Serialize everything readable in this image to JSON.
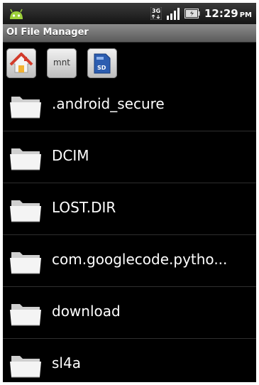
{
  "status_bar": {
    "time": "12:29",
    "ampm": "PM",
    "icons": [
      "android-icon",
      "3g-icon",
      "signal-icon",
      "battery-icon"
    ]
  },
  "title_bar": {
    "title": "OI File Manager"
  },
  "toolbar": {
    "buttons": [
      {
        "name": "home-button",
        "icon": "home-icon",
        "label": ""
      },
      {
        "name": "mnt-button",
        "icon": "",
        "label": "mnt"
      },
      {
        "name": "sdcard-button",
        "icon": "sdcard-icon",
        "label": ""
      }
    ]
  },
  "files": [
    {
      "name": ".android_secure",
      "type": "folder"
    },
    {
      "name": "DCIM",
      "type": "folder"
    },
    {
      "name": "LOST.DIR",
      "type": "folder"
    },
    {
      "name": "com.googlecode.pytho...",
      "type": "folder"
    },
    {
      "name": "download",
      "type": "folder"
    },
    {
      "name": "sl4a",
      "type": "folder"
    }
  ],
  "colors": {
    "background": "#000000",
    "text": "#ffffff",
    "title_bar": "#7a7a7a"
  }
}
